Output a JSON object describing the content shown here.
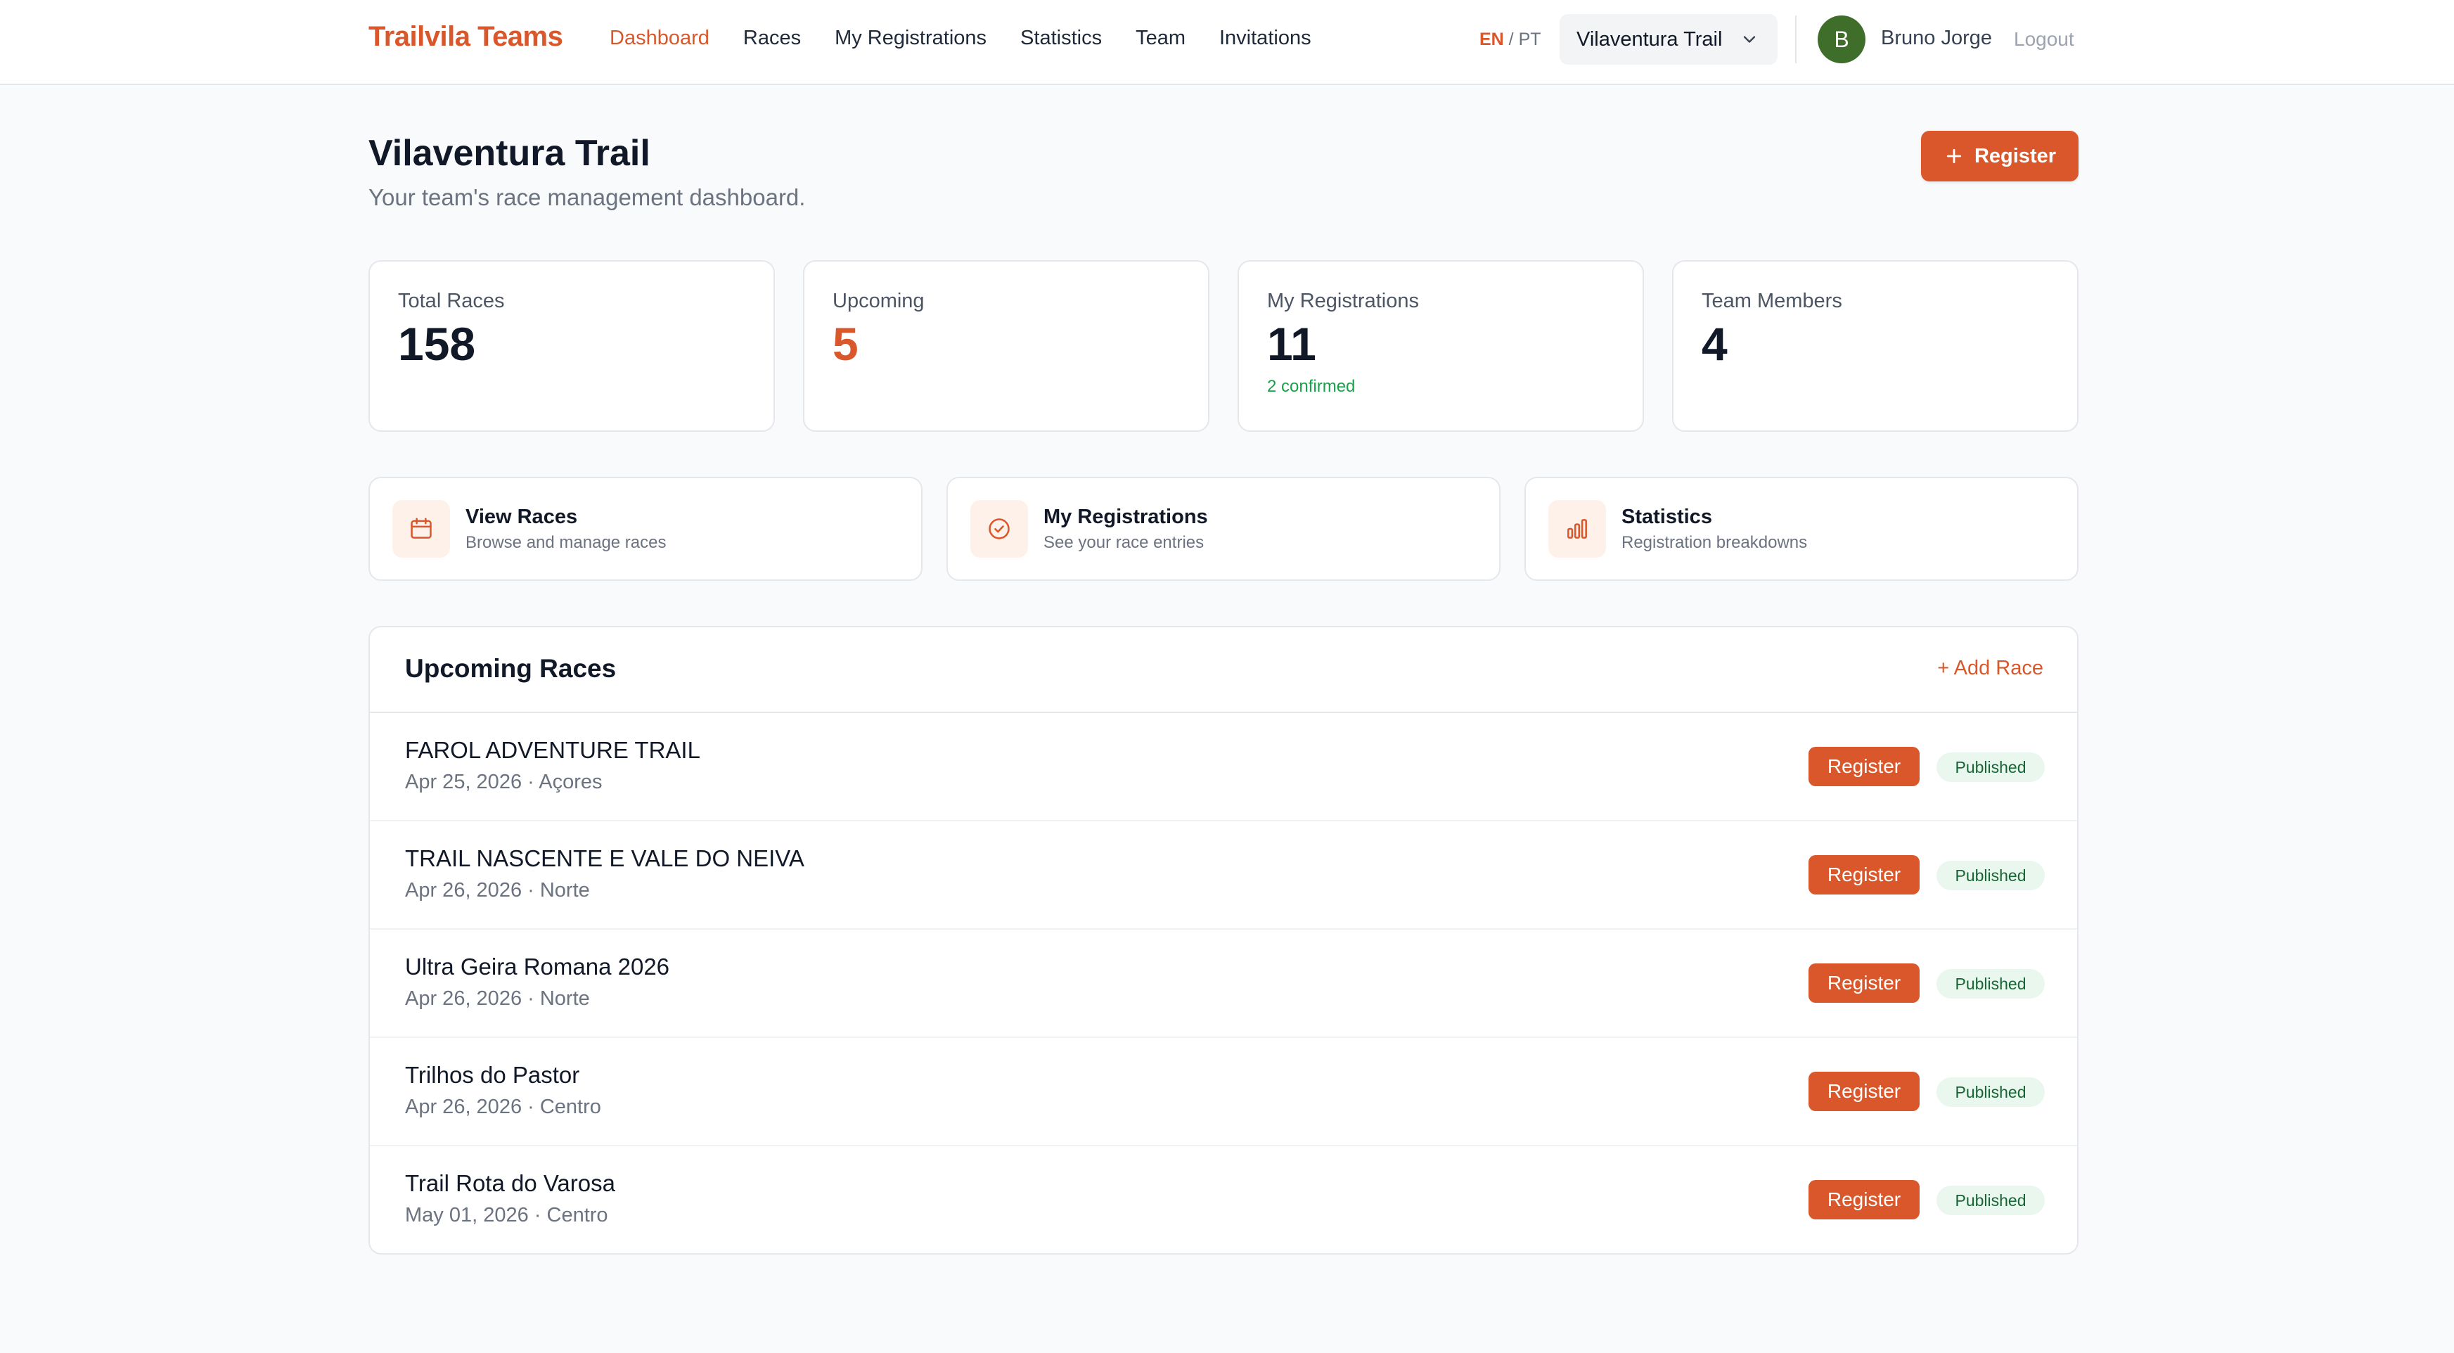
{
  "header": {
    "brand": "Trailvila Teams",
    "nav": [
      {
        "label": "Dashboard",
        "active": true
      },
      {
        "label": "Races"
      },
      {
        "label": "My Registrations"
      },
      {
        "label": "Statistics"
      },
      {
        "label": "Team"
      },
      {
        "label": "Invitations"
      }
    ],
    "lang_active": "EN",
    "lang_sep": " / ",
    "lang_other": "PT",
    "team_select": "Vilaventura Trail",
    "avatar_initial": "B",
    "username": "Bruno Jorge",
    "logout": "Logout"
  },
  "page": {
    "title": "Vilaventura Trail",
    "subtitle": "Your team's race management dashboard.",
    "register_button": "Register"
  },
  "stats": [
    {
      "label": "Total Races",
      "value": "158"
    },
    {
      "label": "Upcoming",
      "value": "5",
      "accent": "#d9572a"
    },
    {
      "label": "My Registrations",
      "value": "11",
      "note": "2 confirmed"
    },
    {
      "label": "Team Members",
      "value": "4"
    }
  ],
  "quick_links": [
    {
      "icon": "calendar-icon",
      "title": "View Races",
      "desc": "Browse and manage races"
    },
    {
      "icon": "check-circle-icon",
      "title": "My Registrations",
      "desc": "See your race entries"
    },
    {
      "icon": "bar-chart-icon",
      "title": "Statistics",
      "desc": "Registration breakdowns"
    }
  ],
  "upcoming": {
    "title": "Upcoming Races",
    "add_label": "+ Add Race",
    "register_label": "Register",
    "status_label": "Published",
    "races": [
      {
        "name": "FAROL ADVENTURE TRAIL",
        "meta": "Apr 25, 2026 · Açores"
      },
      {
        "name": "TRAIL NASCENTE E VALE DO NEIVA",
        "meta": "Apr 26, 2026 · Norte"
      },
      {
        "name": "Ultra Geira Romana 2026",
        "meta": "Apr 26, 2026 · Norte"
      },
      {
        "name": "Trilhos do Pastor",
        "meta": "Apr 26, 2026 · Centro"
      },
      {
        "name": "Trail Rota do Varosa",
        "meta": "May 01, 2026 · Centro"
      }
    ]
  },
  "colors": {
    "accent": "#d9572a",
    "success": "#16a34a",
    "avatar": "#3f6e2a"
  }
}
